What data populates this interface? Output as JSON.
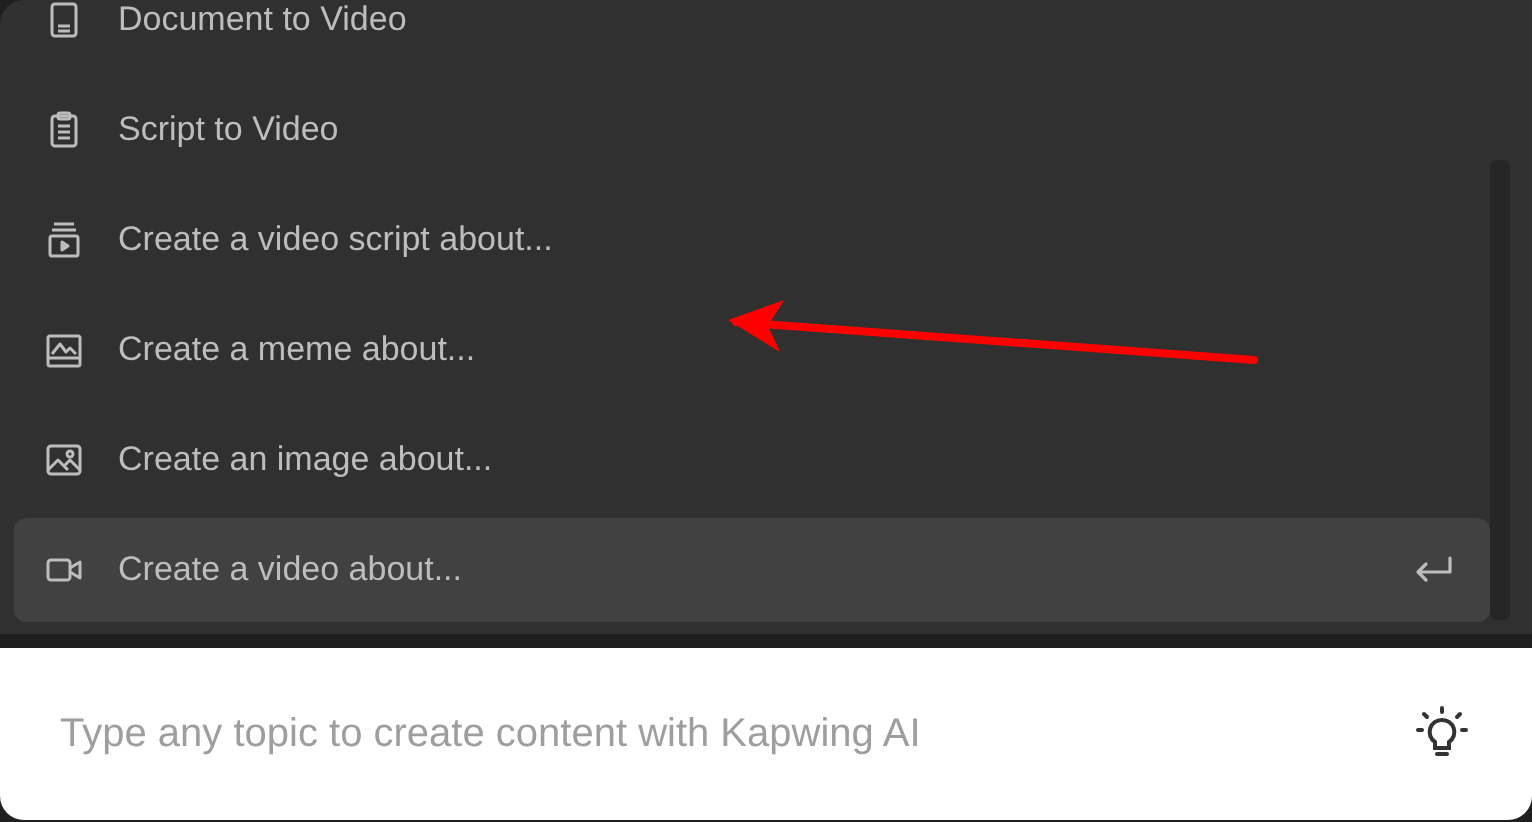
{
  "menu": {
    "items": [
      {
        "kind": "document",
        "label": "Document to Video",
        "selected": false
      },
      {
        "kind": "clipboard",
        "label": "Script to Video",
        "selected": false
      },
      {
        "kind": "script",
        "label": "Create a video script about...",
        "selected": false
      },
      {
        "kind": "meme",
        "label": "Create a meme about...",
        "selected": false
      },
      {
        "kind": "image",
        "label": "Create an image about...",
        "selected": false
      },
      {
        "kind": "video",
        "label": "Create a video about...",
        "selected": true
      }
    ]
  },
  "prompt": {
    "placeholder": "Type any topic to create content with Kapwing AI"
  }
}
